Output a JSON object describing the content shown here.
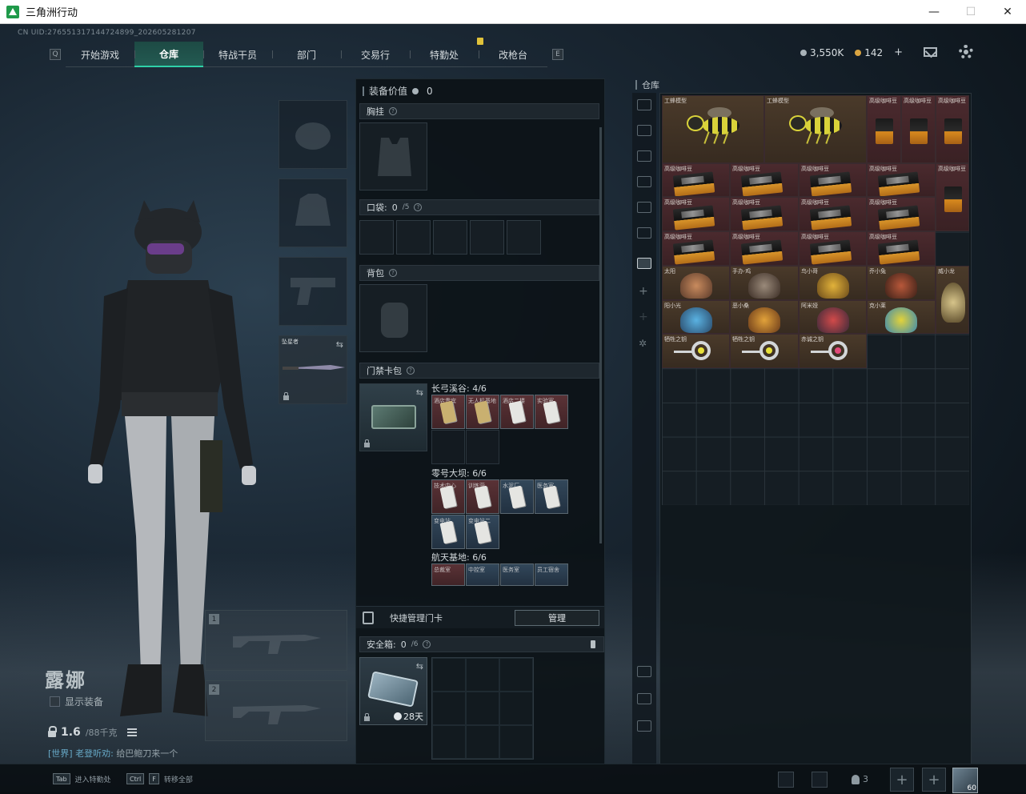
{
  "window": {
    "title": "三角洲行动",
    "min": "—",
    "max": "☐",
    "close": "✕"
  },
  "uid": "CN UID:2765513171447248​99_202605281207",
  "nav": {
    "left_key": "Q",
    "right_key": "E",
    "tabs": [
      "开始游戏",
      "仓库",
      "特战干员",
      "部门",
      "交易行",
      "特勤处",
      "改枪台"
    ],
    "active": 1
  },
  "currency": {
    "silver": "3,550K",
    "gold": "142",
    "plus": "+"
  },
  "character": {
    "name": "露娜",
    "show_equip": "显示装备",
    "weight": "1.6",
    "weight_max": "/88千克",
    "chat_channel": "[世界]",
    "chat_user": "老登听劝:",
    "chat_msg": "给巴鲍刀来一个"
  },
  "equip": {
    "melee_label": "坠星者",
    "weapon1": "1",
    "weapon2": "2"
  },
  "mid": {
    "value_label": "装备价值",
    "value": "0",
    "chest_rig": "胸挂",
    "pocket": "口袋:",
    "pocket_count": "0",
    "pocket_max": "/5",
    "backpack": "背包",
    "keycard_pack": "门禁卡包",
    "groups": [
      {
        "name": "长弓溪谷:",
        "count": "4/6",
        "cards": [
          "酒店贵宾",
          "无人机基地",
          "酒店二楼",
          "实验室"
        ]
      },
      {
        "name": "零号大坝:",
        "count": "6/6",
        "cards": [
          "技术中心",
          "训练营",
          "水泥厂",
          "医务室",
          "变电站",
          "变电站二"
        ]
      },
      {
        "name": "航天基地:",
        "count": "6/6",
        "cards": [
          "总裁室",
          "中控室",
          "医务室",
          "员工宿舍"
        ]
      }
    ],
    "quick_manage": "快捷管理门卡",
    "manage_btn": "管理",
    "safebox": "安全箱:",
    "safebox_count": "0",
    "safebox_max": "/6",
    "safebox_days": "28天"
  },
  "stash": {
    "title": "仓库",
    "items": [
      {
        "label": "工蜂模型",
        "kind": "wasp"
      },
      {
        "label": "工蜂模型",
        "kind": "wasp"
      },
      {
        "label": "高级咖啡豆",
        "kind": "coffee"
      },
      {
        "label": "高级咖啡豆",
        "kind": "coffee"
      },
      {
        "label": "高级咖啡豆",
        "kind": "coffee"
      },
      {
        "label": "高级咖啡豆",
        "kind": "coffee"
      },
      {
        "label": "高级咖啡豆",
        "kind": "cigar"
      },
      {
        "label": "太阳",
        "kind": "figure"
      },
      {
        "label": "手办·鸡",
        "kind": "figure"
      },
      {
        "label": "鸟小哥",
        "kind": "figure"
      },
      {
        "label": "乔小兔",
        "kind": "figure"
      },
      {
        "label": "威小龙",
        "kind": "figure"
      },
      {
        "label": "阳小光",
        "kind": "figure"
      },
      {
        "label": "恶小桑",
        "kind": "figure"
      },
      {
        "label": "阿米娅",
        "kind": "figure"
      },
      {
        "label": "克小莱",
        "kind": "figure"
      },
      {
        "label": "牺牲之钥",
        "kind": "key"
      },
      {
        "label": "牺牲之钥",
        "kind": "key"
      },
      {
        "label": "赤诚之钥",
        "kind": "key"
      }
    ]
  },
  "bottom": {
    "hint1_key": "Tab",
    "hint1": "进入特勤处",
    "hint2_key1": "Ctrl",
    "hint2_key2": "F",
    "hint2": "转移全部",
    "friends": "3",
    "plus": "+",
    "level": "60"
  }
}
